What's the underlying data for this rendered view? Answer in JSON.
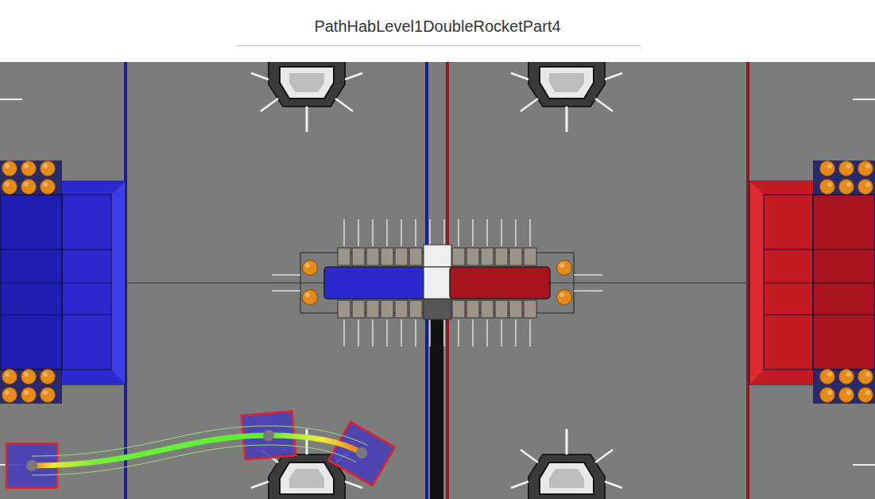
{
  "window": {
    "title": "PathHabLevel1DoubleRocketPart4"
  }
}
